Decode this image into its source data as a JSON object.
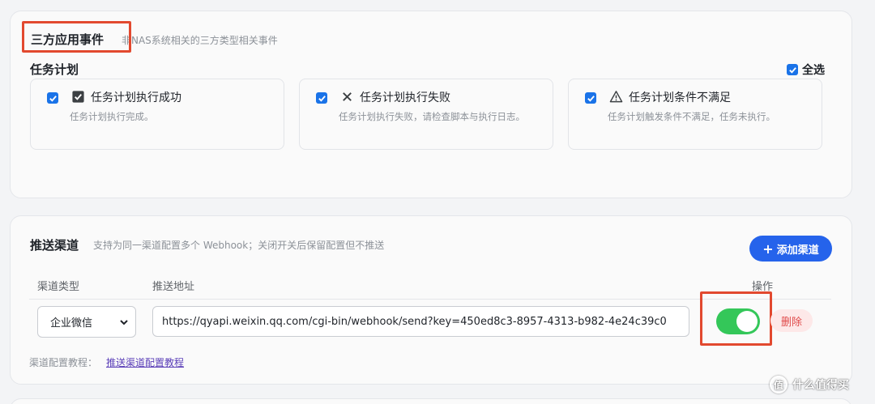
{
  "third_party": {
    "title": "三方应用事件",
    "desc": "非NAS系统相关的三方类型相关事件",
    "group_title": "任务计划",
    "select_all_label": "全选",
    "tasks": [
      {
        "title": "任务计划执行成功",
        "desc": "任务计划执行完成。",
        "icon": "check-box-icon"
      },
      {
        "title": "任务计划执行失败",
        "desc": "任务计划执行失败，请检查脚本与执行日志。",
        "icon": "x-icon"
      },
      {
        "title": "任务计划条件不满足",
        "desc": "任务计划触发条件不满足，任务未执行。",
        "icon": "warning-icon"
      }
    ]
  },
  "push": {
    "title": "推送渠道",
    "desc": "支持为同一渠道配置多个 Webhook；关闭开关后保留配置但不推送",
    "add_button": "添加渠道",
    "add_button_icon": "+",
    "col_type": "渠道类型",
    "col_url": "推送地址",
    "col_action": "操作",
    "row": {
      "type_value": "企业微信",
      "url_value": "https://qyapi.weixin.qq.com/cgi-bin/webhook/send?key=450ed8c3-8957-4313-b982-4e24c39c0",
      "enabled": true,
      "delete_label": "删除"
    },
    "tutorial_label": "渠道配置教程：",
    "tutorial_link": "推送渠道配置教程"
  },
  "watermark": {
    "logo_char": "值",
    "text": "什么值得买"
  },
  "colors": {
    "accent": "#2563eb",
    "toggle_on": "#34c759",
    "highlight_red": "#e2492f",
    "delete_red": "#e04b4b"
  }
}
